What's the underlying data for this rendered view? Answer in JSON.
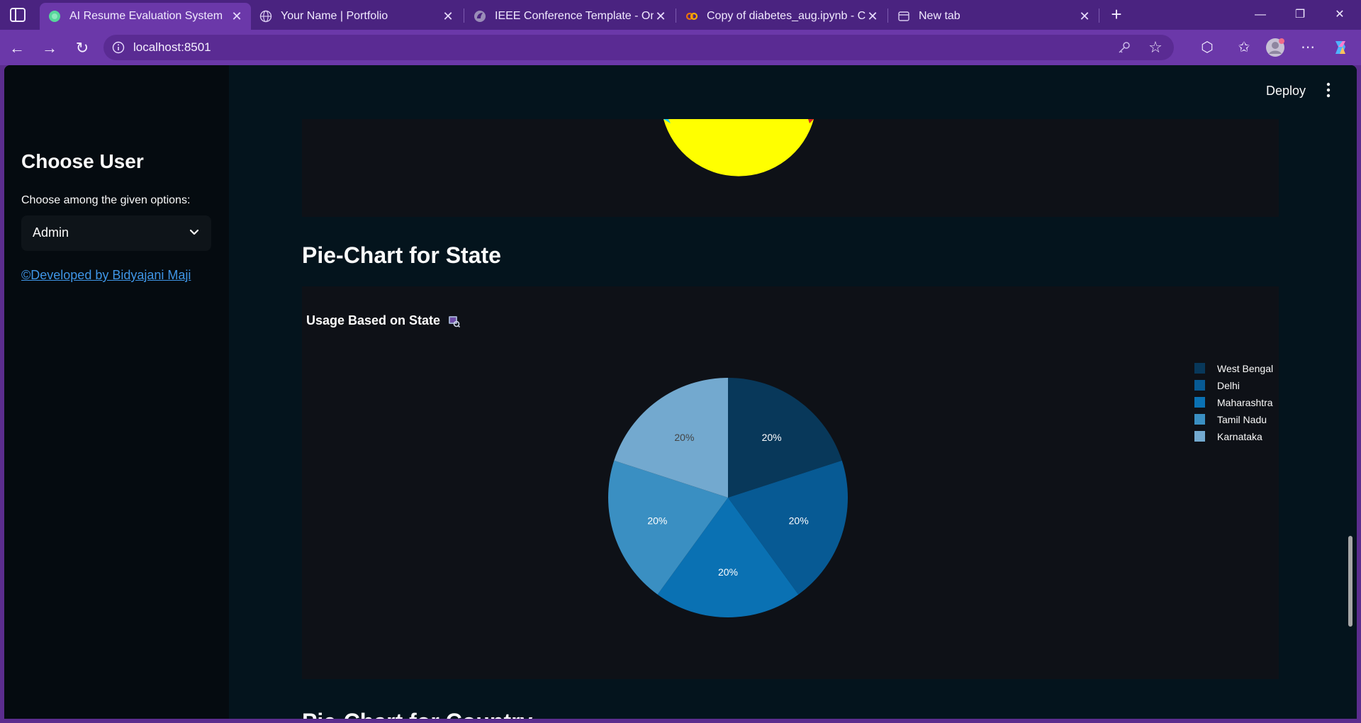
{
  "browser": {
    "tabs": [
      {
        "title": "AI Resume Evaluation System",
        "active": true,
        "icon": "streamlit-icon"
      },
      {
        "title": "Your Name | Portfolio",
        "active": false,
        "icon": "globe-icon"
      },
      {
        "title": "IEEE Conference Template - Online",
        "active": false,
        "icon": "overleaf-icon"
      },
      {
        "title": "Copy of diabetes_aug.ipynb - Col",
        "active": false,
        "icon": "colab-icon"
      },
      {
        "title": "New tab",
        "active": false,
        "icon": "newtab-icon"
      }
    ],
    "url": "localhost:8501"
  },
  "sidebar": {
    "heading": "Choose User",
    "select_label": "Choose among the given options:",
    "selected": "Admin",
    "credit": "©Developed by Bidyajani Maji"
  },
  "header": {
    "deploy_label": "Deploy"
  },
  "main": {
    "section_title": "Pie-Chart for State",
    "next_section_title": "Pie-Chart for Country"
  },
  "chart_data": {
    "type": "pie",
    "title": "Usage Based on State",
    "categories": [
      "West Bengal",
      "Delhi",
      "Maharashtra",
      "Tamil Nadu",
      "Karnataka"
    ],
    "values": [
      20,
      20,
      20,
      20,
      20
    ],
    "labels": [
      "20%",
      "20%",
      "20%",
      "20%",
      "20%"
    ],
    "colors": [
      "#08385a",
      "#075a94",
      "#0a71b3",
      "#3a8fc2",
      "#73a9cf"
    ],
    "label_colors": [
      "#ffffff",
      "#ffffff",
      "#ffffff",
      "#ffffff",
      "#444444"
    ],
    "legend": "top-right"
  }
}
